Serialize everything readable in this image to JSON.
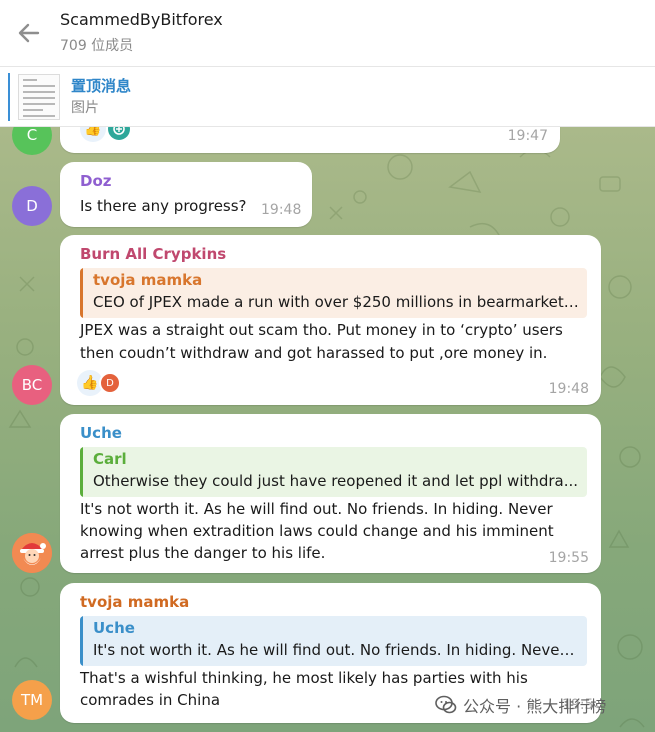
{
  "header": {
    "title": "ScammedByBitforex",
    "subtitle": "709 位成员"
  },
  "pinned": {
    "title": "置顶消息",
    "subtitle": "图片"
  },
  "messages": [
    {
      "avatar_initials": "C",
      "avatar_color": "#57c35a",
      "time": "19:47",
      "reactions": [
        "thumbs-up",
        "sticker"
      ]
    },
    {
      "sender": "Doz",
      "sender_color": "#8f5fd0",
      "avatar_initials": "D",
      "avatar_color": "#8a6fd8",
      "text": "Is there any progress?",
      "time": "19:48"
    },
    {
      "sender": "Burn All Crypkins",
      "sender_color": "#c0486e",
      "avatar_initials": "BC",
      "avatar_color": "#e8607f",
      "quote_name": "tvoja mamka",
      "quote_color": "#d8762d",
      "quote_bg": "#fbeee4",
      "quote_text": "CEO of JPEX made a run with over $250 millions in bearmarket f...",
      "lines": [
        "JPEX was a straight out scam tho. Put money in to ‘crypto’ users",
        "then coudn’t withdraw and got harassed to put ,ore money in."
      ],
      "reaction_avatar": "D",
      "time": "19:48"
    },
    {
      "sender": "Uche",
      "sender_color": "#3a8fc9",
      "avatar_icon": "santa-avatar",
      "quote_name": "Carl",
      "quote_color": "#5bae3b",
      "quote_bg": "#eaf5e4",
      "quote_text": "Otherwise they could just have reopened it and let ppl withdra...",
      "lines": [
        "It's not worth it. As he will find out. No friends.  In hiding. Never",
        "knowing when extradition laws could change and his imminent",
        "arrest  plus the danger to his life."
      ],
      "time": "19:55"
    },
    {
      "sender": "tvoja mamka",
      "sender_color": "#d06a22",
      "avatar_initials": "TM",
      "avatar_color": "#f5a04a",
      "quote_name": "Uche",
      "quote_color": "#3a8fc9",
      "quote_bg": "#e4eff8",
      "quote_text": "It's not worth it. As he will find out. No friends.  In hiding. Never ...",
      "lines": [
        "That's a wishful thinking, he most likely has parties with his",
        "comrades in China"
      ],
      "time": "19:5"
    }
  ],
  "watermark": {
    "text": "公众号 · 熊大排行榜"
  }
}
